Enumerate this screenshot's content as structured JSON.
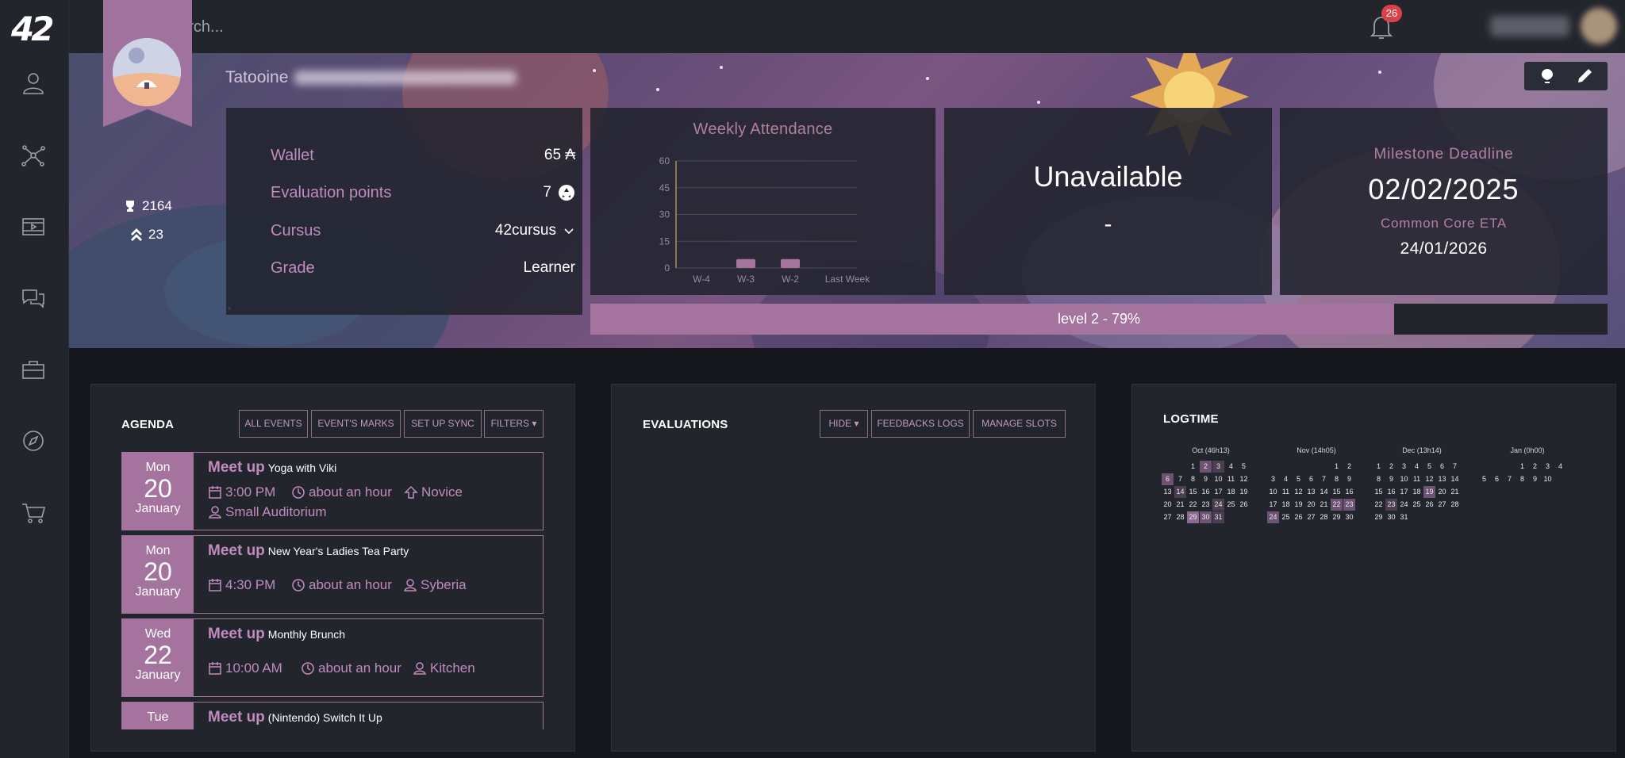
{
  "search": {
    "placeholder": "search..."
  },
  "notifications": {
    "count": "26"
  },
  "sidebar": {
    "icons": [
      "profile-icon",
      "network-icon",
      "media-icon",
      "chat-icon",
      "briefcase-icon",
      "compass-icon",
      "cart-icon"
    ]
  },
  "profile": {
    "coalition": "Tatooine",
    "trophy_points": "2164",
    "rank_points": "23"
  },
  "info": {
    "wallet_label": "Wallet",
    "wallet_value": "65 ₳",
    "eval_label": "Evaluation points",
    "eval_value": "7",
    "cursus_label": "Cursus",
    "cursus_value": "42cursus",
    "grade_label": "Grade",
    "grade_value": "Learner"
  },
  "attendance": {
    "title": "Weekly Attendance",
    "chart_data": {
      "type": "bar",
      "title": "Weekly Attendance",
      "categories": [
        "W-4",
        "W-3",
        "W-2",
        "Last Week"
      ],
      "values": [
        0,
        5,
        5,
        0
      ],
      "yticks": [
        60,
        45,
        30,
        15,
        0
      ],
      "ylim": [
        0,
        60
      ],
      "grid": true
    }
  },
  "availability": {
    "status": "Unavailable",
    "detail": "-"
  },
  "milestone": {
    "label": "Milestone Deadline",
    "date": "02/02/2025",
    "eta_label": "Common Core ETA",
    "eta_date": "24/01/2026"
  },
  "level": {
    "label": "level 2 - 79%",
    "progress": 0.79
  },
  "agenda": {
    "title": "AGENDA",
    "buttons": [
      "ALL EVENTS",
      "EVENT'S MARKS",
      "SET UP SYNC",
      "FILTERS"
    ],
    "events": [
      {
        "weekday": "Mon",
        "day": "20",
        "month": "January",
        "kind": "Meet up",
        "name": "Yoga with Viki",
        "time": "3:00 PM",
        "duration": "about an hour",
        "level": "Novice",
        "location": "Small Auditorium"
      },
      {
        "weekday": "Mon",
        "day": "20",
        "month": "January",
        "kind": "Meet up",
        "name": "New Year's Ladies Tea Party",
        "time": "4:30 PM",
        "duration": "about an hour",
        "location": "Syberia"
      },
      {
        "weekday": "Wed",
        "day": "22",
        "month": "January",
        "kind": "Meet up",
        "name": "Monthly Brunch",
        "time": "10:00 AM",
        "duration": "about an hour",
        "location": "Kitchen"
      },
      {
        "weekday": "Tue",
        "kind": "Meet up",
        "name": "(Nintendo) Switch It Up"
      }
    ]
  },
  "evaluations": {
    "title": "EVALUATIONS",
    "buttons": [
      "HIDE",
      "FEEDBACKS LOGS",
      "MANAGE SLOTS"
    ]
  },
  "logtime": {
    "title": "LOGTIME",
    "months": [
      {
        "title": "Oct (46h13)",
        "offset": 2,
        "days": 31,
        "levels": {
          "2": 2,
          "3": 1,
          "6": 2,
          "14": 1,
          "24": 1,
          "29": 3,
          "30": 2,
          "31": 1
        }
      },
      {
        "title": "Nov (14h05)",
        "offset": 5,
        "days": 30,
        "levels": {
          "22": 2,
          "23": 2,
          "24": 2
        }
      },
      {
        "title": "Dec (13h14)",
        "offset": 0,
        "days": 31,
        "levels": {
          "19": 2,
          "23": 1
        }
      },
      {
        "title": "Jan (0h00)",
        "offset": 3,
        "days": 10,
        "levels": {}
      }
    ]
  },
  "colors": {
    "accent": "#a4739e",
    "label": "#c08bbe",
    "panel": "#23252d",
    "background": "#15171c"
  }
}
